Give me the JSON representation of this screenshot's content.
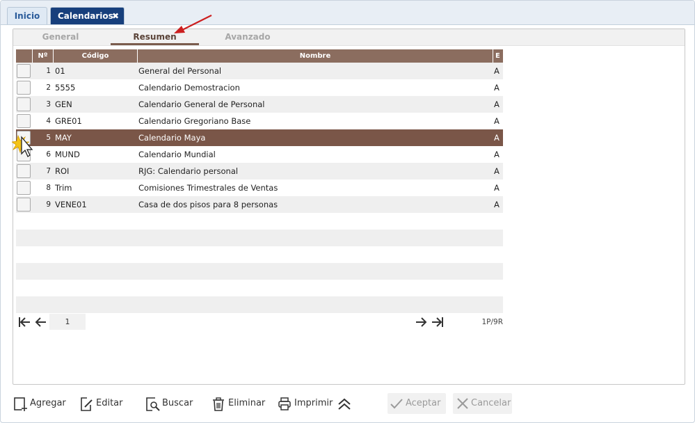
{
  "tabs": {
    "inicio": "Inicio",
    "calendarios": "Calendarios",
    "close_glyph": "✖"
  },
  "subtabs": {
    "general": "General",
    "resumen": "Resumen",
    "avanzado": "Avanzado",
    "active": "Resumen"
  },
  "grid": {
    "columns": {
      "no": "Nº",
      "codigo": "Código",
      "nombre": "Nombre",
      "e": "E"
    },
    "selected_row": 5,
    "rows": [
      {
        "no": "1",
        "codigo": "01",
        "nombre": "General del Personal",
        "e": "A"
      },
      {
        "no": "2",
        "codigo": "5555",
        "nombre": "Calendario Demostracion",
        "e": "A"
      },
      {
        "no": "3",
        "codigo": "GEN",
        "nombre": "Calendario General de Personal",
        "e": "A"
      },
      {
        "no": "4",
        "codigo": "GRE01",
        "nombre": "Calendario Gregoriano Base",
        "e": "A"
      },
      {
        "no": "5",
        "codigo": "MAY",
        "nombre": "Calendario Maya",
        "e": "A"
      },
      {
        "no": "6",
        "codigo": "MUND",
        "nombre": "Calendario Mundial",
        "e": "A"
      },
      {
        "no": "7",
        "codigo": "ROI",
        "nombre": "RJG: Calendario personal",
        "e": "A"
      },
      {
        "no": "8",
        "codigo": "Trim",
        "nombre": "Comisiones Trimestrales de Ventas",
        "e": "A"
      },
      {
        "no": "9",
        "codigo": "VENE01",
        "nombre": "Casa de dos pisos para 8 personas",
        "e": "A"
      }
    ]
  },
  "pager": {
    "page": "1",
    "count": "1P/9R"
  },
  "toolbar": {
    "agregar": "Agregar",
    "editar": "Editar",
    "buscar": "Buscar",
    "eliminar": "Eliminar",
    "imprimir": "Imprimir",
    "aceptar": "Aceptar",
    "cancelar": "Cancelar"
  },
  "colors": {
    "header": "#8b6d5f",
    "selected_row": "#7a5648",
    "active_tab": "#173f7c",
    "annotation_arrow": "#cc1f1f"
  }
}
